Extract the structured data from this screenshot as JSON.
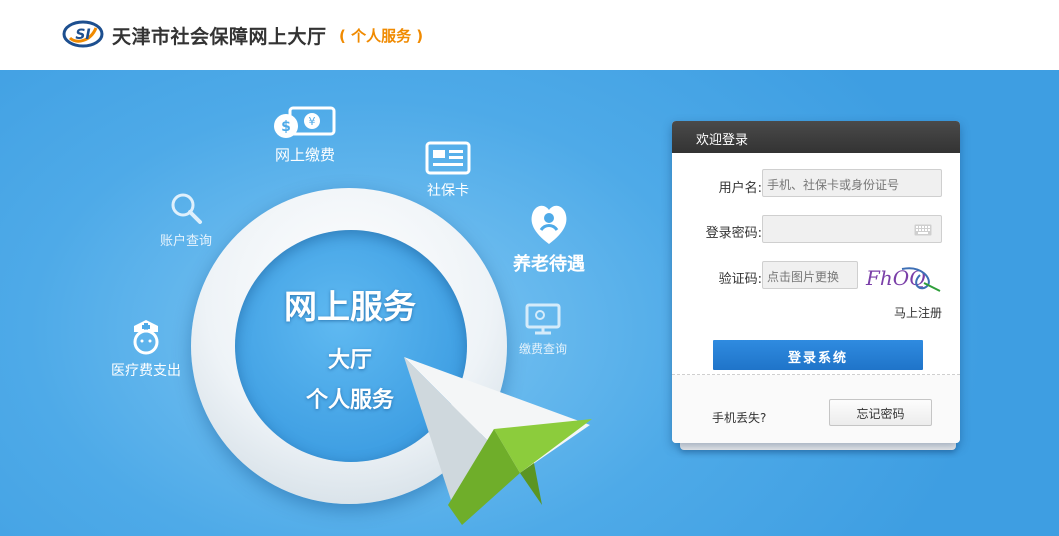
{
  "header": {
    "logo_text": "SI",
    "title": "天津市社会保障网上大厅",
    "subtitle": "( 个人服务 )"
  },
  "banner": {
    "center": {
      "line1": "网上服务",
      "line2": "大厅",
      "line3": "个人服务"
    },
    "features": [
      {
        "label": "网上缴费",
        "icon": "money-icon"
      },
      {
        "label": "社保卡",
        "icon": "card-icon"
      },
      {
        "label": "账户查询",
        "icon": "search-icon"
      },
      {
        "label": "养老待遇",
        "icon": "pension-icon"
      },
      {
        "label": "缴费查询",
        "icon": "monitor-icon"
      },
      {
        "label": "医疗费支出",
        "icon": "nurse-icon"
      }
    ]
  },
  "login": {
    "title": "欢迎登录",
    "username_label": "用户名:",
    "username_placeholder": "手机、社保卡或身份证号",
    "password_label": "登录密码:",
    "captcha_label": "验证码:",
    "captcha_placeholder": "点击图片更换",
    "captcha_text": "FhOQ",
    "register_link": "马上注册",
    "login_button": "登录系统",
    "lost_phone": "手机丢失?",
    "forgot_button": "忘记密码"
  },
  "colors": {
    "accent_orange": "#f08a00",
    "banner_blue": "#4eaae8",
    "login_button": "#1f74c9",
    "plane_green": "#7cb832"
  }
}
